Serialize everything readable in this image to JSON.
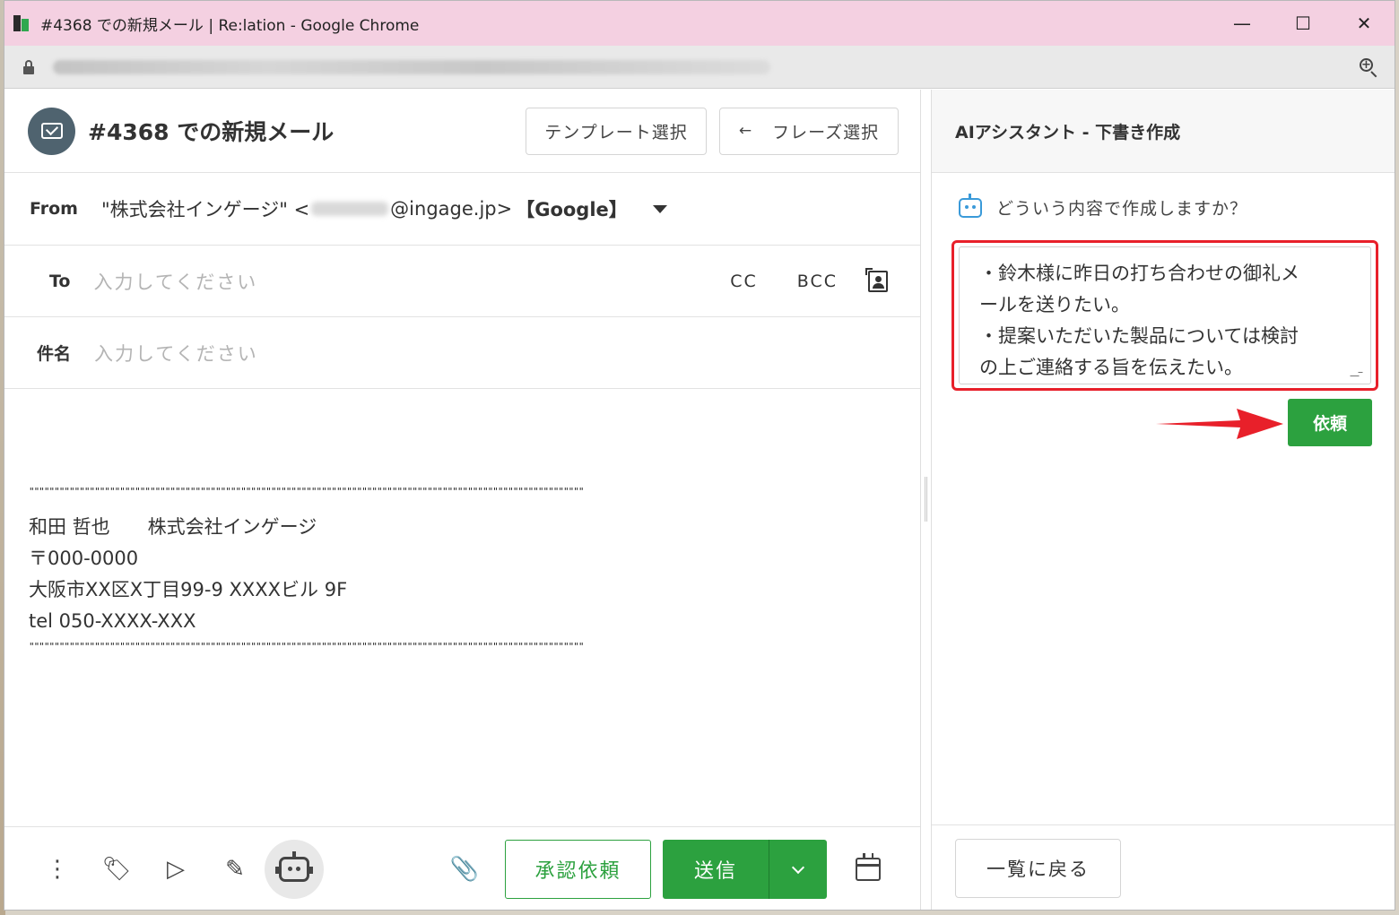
{
  "window": {
    "title": "#4368 での新規メール | Re:lation - Google Chrome",
    "minimize_glyph": "—",
    "maximize_glyph": "☐",
    "close_glyph": "✕"
  },
  "composer": {
    "title": "#4368 での新規メール",
    "template_button": "テンプレート選択",
    "phrase_button": "フレーズ選択",
    "phrase_arrow": "←",
    "from": {
      "label": "From",
      "name": "\"株式会社インゲージ\" <",
      "domain": "@ingage.jp>",
      "account": "【Google】"
    },
    "to": {
      "label": "To",
      "placeholder": "入力してください",
      "cc": "CC",
      "bcc": "BCC"
    },
    "subject": {
      "label": "件名",
      "placeholder": "入力してください"
    },
    "signature": {
      "separator": "\"\"\"\"\"\"\"\"\"\"\"\"\"\"\"\"\"\"\"\"\"\"\"\"\"\"\"\"\"\"\"\"\"\"\"\"\"\"\"\"\"\"\"\"\"\"\"\"\"\"\"\"\"\"\"\"\"\"\"\"\"\"\"\"\"\"\"\"\"\"\"\"\"\"\"\"\"\"\"\"\"\"\"\"\"\"\"\"\"\"\"\"\"\"\"\"\"\"\"\"\"\"\"\"\"\"\"\"\"\"",
      "line1": "和田 哲也　　株式会社インゲージ",
      "line2": "〒000-0000",
      "line3": "大阪市XX区X丁目99-9 XXXXビル 9F",
      "line4": "tel 050-XXXX-XXX"
    },
    "footer": {
      "approval_button": "承認依頼",
      "send_button": "送信",
      "more_glyph": "⋮",
      "tag_glyph": "🏷",
      "label_glyph": "▷",
      "edit_glyph": "✎",
      "clip_glyph": "📎"
    }
  },
  "ai_panel": {
    "title": "AIアシスタント - 下書き作成",
    "question": "どういう内容で作成しますか？",
    "request_text_line1": "・鈴木様に昨日の打ち合わせの御礼メ",
    "request_text_line2": "ールを送りたい。",
    "request_text_line3": "・提案いただいた製品については検討",
    "request_text_line4": "の上ご連絡する旨を伝えたい。",
    "request_button": "依頼",
    "back_button": "一覧に戻る"
  },
  "colors": {
    "titlebar": "#f4d0e1",
    "primary_green": "#2ca13f",
    "highlight_red": "#e8202a",
    "bot_blue": "#3a9ad9"
  }
}
